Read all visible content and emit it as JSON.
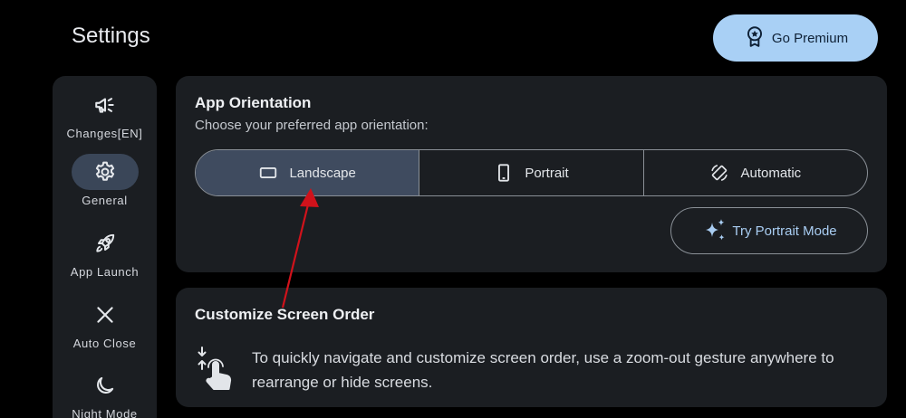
{
  "header": {
    "title": "Settings",
    "premium_label": "Go Premium"
  },
  "sidebar": {
    "items": [
      {
        "label": "Changes[EN]",
        "icon": "megaphone-icon",
        "active": false
      },
      {
        "label": "General",
        "icon": "gear-icon",
        "active": true
      },
      {
        "label": "App Launch",
        "icon": "rocket-icon",
        "active": false
      },
      {
        "label": "Auto Close",
        "icon": "close-icon",
        "active": false
      },
      {
        "label": "Night Mode",
        "icon": "moon-icon",
        "active": false
      }
    ]
  },
  "orientation": {
    "title": "App Orientation",
    "subtitle": "Choose your preferred app orientation:",
    "options": [
      {
        "label": "Landscape",
        "icon": "landscape-icon",
        "selected": true
      },
      {
        "label": "Portrait",
        "icon": "portrait-icon",
        "selected": false
      },
      {
        "label": "Automatic",
        "icon": "auto-rotate-icon",
        "selected": false
      }
    ],
    "try_label": "Try Portrait Mode"
  },
  "screen_order": {
    "title": "Customize Screen Order",
    "description": "To quickly navigate and customize screen order, use a zoom-out gesture anywhere to rearrange or hide screens."
  },
  "colors": {
    "background": "#000000",
    "card": "#1b1e22",
    "accent": "#a9d0f5",
    "selected_segment": "#3f4b5f",
    "annotation_arrow": "#d0121b"
  }
}
